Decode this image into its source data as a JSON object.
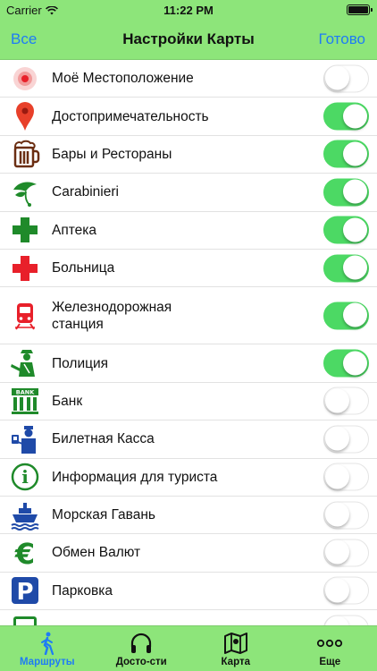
{
  "status_bar": {
    "carrier": "Carrier",
    "time": "11:22 PM"
  },
  "nav": {
    "left": "Все",
    "title": "Настройки Карты",
    "right": "Готово"
  },
  "items": [
    {
      "label": "Моё Местоположение",
      "icon": "my-location-icon",
      "on": false
    },
    {
      "label": "Достопримечательность",
      "icon": "landmark-pin-icon",
      "on": true
    },
    {
      "label": "Бары и Рестораны",
      "icon": "beer-mug-icon",
      "on": true
    },
    {
      "label": "Carabinieri",
      "icon": "carabinieri-plume-icon",
      "on": true
    },
    {
      "label": "Аптека",
      "icon": "pharmacy-cross-icon",
      "on": true
    },
    {
      "label": "Больница",
      "icon": "hospital-cross-icon",
      "on": true
    },
    {
      "label": "Железнодорожная\nстанция",
      "icon": "train-icon",
      "on": true
    },
    {
      "label": "Полиция",
      "icon": "police-officer-icon",
      "on": true
    },
    {
      "label": "Банк",
      "icon": "bank-building-icon",
      "on": false
    },
    {
      "label": "Билетная Касса",
      "icon": "ticket-office-icon",
      "on": false
    },
    {
      "label": "Информация для туриста",
      "icon": "info-icon",
      "on": false
    },
    {
      "label": "Морская Гавань",
      "icon": "ship-icon",
      "on": false
    },
    {
      "label": "Обмен Валют",
      "icon": "euro-icon",
      "on": false
    },
    {
      "label": "Парковка",
      "icon": "parking-icon",
      "on": false
    },
    {
      "label": "",
      "icon": "bus-icon",
      "on": false
    }
  ],
  "icon_texts": {
    "bank": "BANK",
    "info": "i",
    "euro": "€",
    "parking": "P"
  },
  "tabs": [
    {
      "label": "Маршруты",
      "icon": "walking-person-icon",
      "active": true
    },
    {
      "label": "Досто-сти",
      "icon": "headphones-icon",
      "active": false
    },
    {
      "label": "Карта",
      "icon": "map-icon",
      "active": false
    },
    {
      "label": "Еще",
      "icon": "more-dots-icon",
      "active": false
    }
  ],
  "colors": {
    "bar_green": "#8de57a",
    "link_blue": "#1e7cf5",
    "toggle_on": "#4cd964",
    "icon_green": "#1f8a2a",
    "icon_red": "#e8202a",
    "icon_blue": "#1f4aa8"
  }
}
